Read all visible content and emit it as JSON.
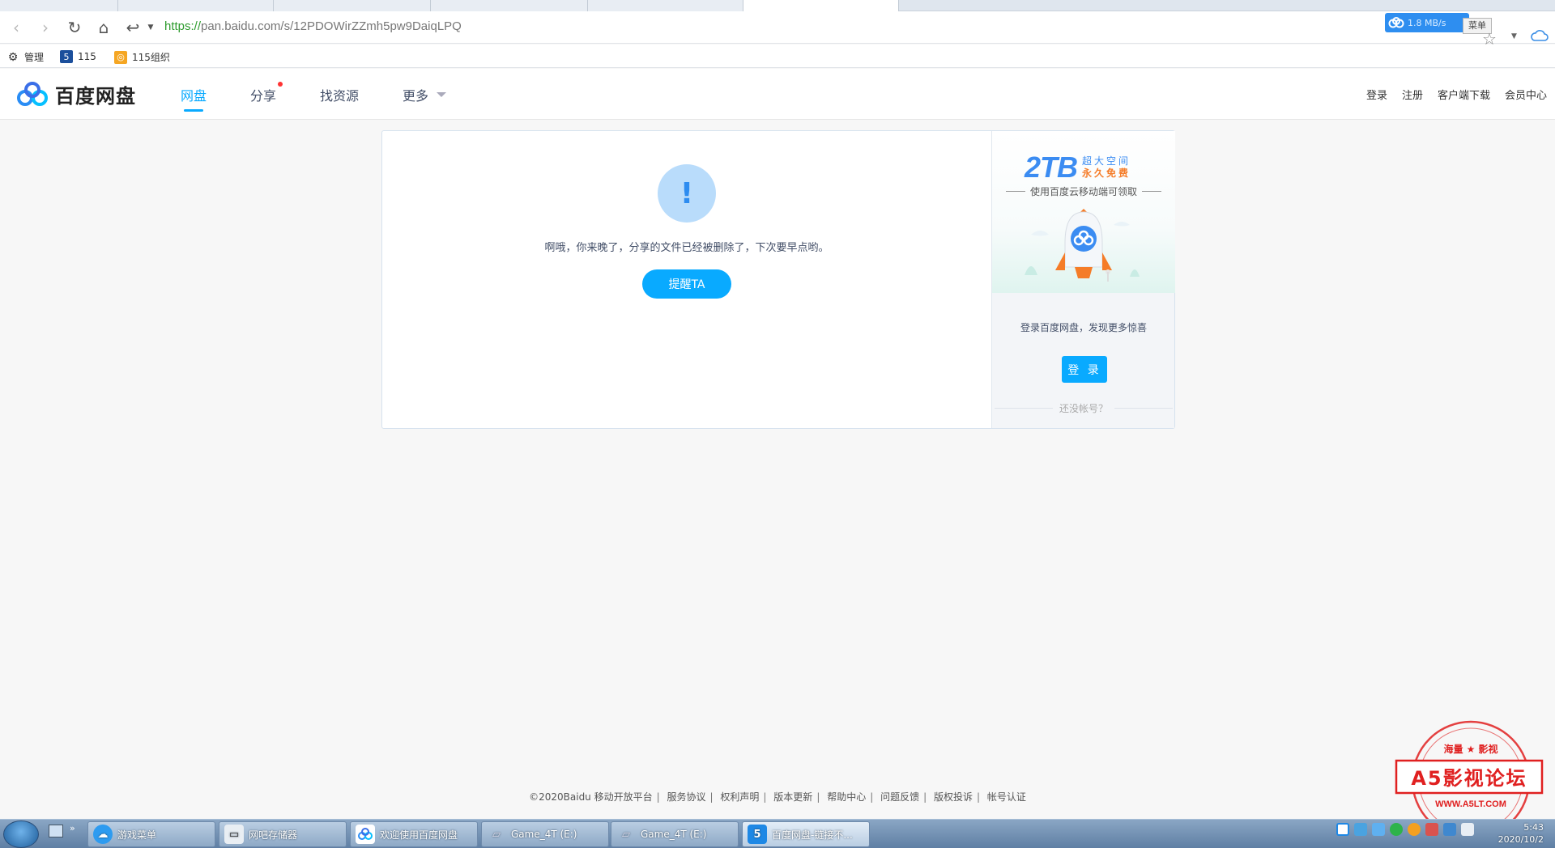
{
  "browser": {
    "url_scheme": "https://",
    "url_rest": "pan.baidu.com/s/12PDOWirZZmh5pw9DaiqLPQ",
    "ext_speed": "1.8 MB/s",
    "tooltip": "菜单"
  },
  "bookmarks": [
    {
      "label": "管理",
      "icon": "gear-icon"
    },
    {
      "label": "115",
      "icon": "115-icon"
    },
    {
      "label": "115组织",
      "icon": "115-org-icon"
    }
  ],
  "header": {
    "logo_text": "百度网盘",
    "nav": [
      {
        "label": "网盘"
      },
      {
        "label": "分享"
      },
      {
        "label": "找资源"
      },
      {
        "label": "更多"
      }
    ],
    "right": [
      {
        "label": "登录"
      },
      {
        "label": "注册"
      },
      {
        "label": "客户端下载"
      },
      {
        "label": "会员中心"
      }
    ]
  },
  "main": {
    "icon_mark": "!",
    "message": "啊哦，你来晚了，分享的文件已经被删除了，下次要早点哟。",
    "remind_button": "提醒TA"
  },
  "sidebar": {
    "promo_big": "2TB",
    "promo_line1": "超大空间",
    "promo_line2": "永久免费",
    "promo_sub": "使用百度云移动端可领取",
    "login_tip": "登录百度网盘，发现更多惊喜",
    "login_button": "登 录",
    "no_account": "还没帐号？"
  },
  "footer": {
    "links": [
      "©2020Baidu",
      "移动开放平台",
      "服务协议",
      "权利声明",
      "版本更新",
      "帮助中心",
      "问题反馈",
      "版权投诉",
      "帐号认证"
    ]
  },
  "stamp": {
    "top": "海量 ★ 影视",
    "main": "A5影视论坛",
    "url": "WWW.A5LT.COM"
  },
  "taskbar": {
    "items": [
      {
        "label": "游戏菜单"
      },
      {
        "label": "网吧存储器"
      },
      {
        "label": "欢迎使用百度网盘"
      },
      {
        "label": "Game_4T (E:)"
      },
      {
        "label": "Game_4T (E:)"
      },
      {
        "label": "百度网盘-链接不..."
      }
    ],
    "time": "5:43",
    "date": "2020/10/2"
  },
  "colors": {
    "accent": "#09aaff",
    "warn_bg": "#b9dcfb",
    "red_dot": "#ff3333"
  }
}
